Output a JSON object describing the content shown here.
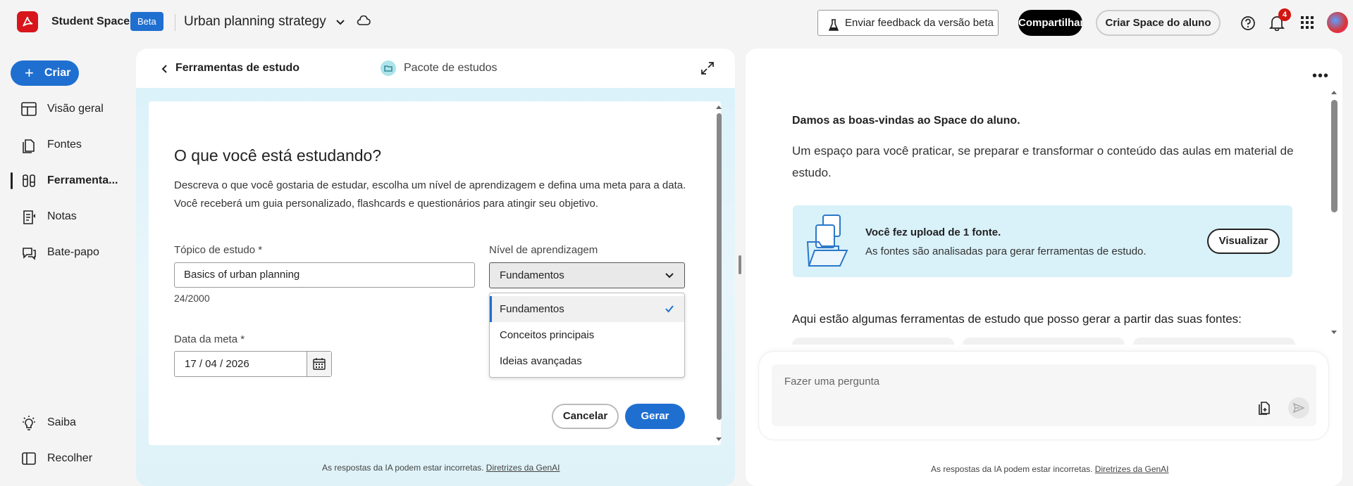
{
  "topbar": {
    "brand": "Student Spaces",
    "beta": "Beta",
    "document_title": "Urban planning strategy",
    "feedback_label": "Enviar feedback da versão beta",
    "share_label": "Compartilhar",
    "create_space_label": "Criar Space do aluno",
    "notification_count": "4"
  },
  "sidebar": {
    "create_label": "Criar",
    "items": [
      {
        "label": "Visão geral",
        "icon": "layout-icon"
      },
      {
        "label": "Fontes",
        "icon": "sources-icon"
      },
      {
        "label": "Ferramenta...",
        "icon": "tools-icon",
        "active": true
      },
      {
        "label": "Notas",
        "icon": "notes-icon"
      },
      {
        "label": "Bate-papo",
        "icon": "chat-icon"
      }
    ],
    "bottom": [
      {
        "label": "Saiba",
        "icon": "lightbulb-icon"
      },
      {
        "label": "Recolher",
        "icon": "collapse-icon"
      }
    ]
  },
  "left_panel": {
    "back_label": "Ferramentas de estudo",
    "pack_label": "Pacote de estudos",
    "form": {
      "title": "O que você está estudando?",
      "description_line1": "Descreva o que você gostaria de estudar, escolha um nível de aprendizagem e defina uma meta para a data.",
      "description_line2": "Você receberá um guia personalizado, flashcards e questionários para atingir seu objetivo.",
      "topic_label": "Tópico de estudo *",
      "topic_value": "Basics of urban planning",
      "char_count": "24/2000",
      "level_label": "Nível de aprendizagem",
      "level_value": "Fundamentos",
      "level_options": [
        "Fundamentos",
        "Conceitos principais",
        "Ideias avançadas"
      ],
      "date_label": "Data da meta *",
      "date_value": "17 / 04 / 2026",
      "cancel_label": "Cancelar",
      "generate_label": "Gerar"
    },
    "footnote": "As respostas da IA podem estar incorretas.",
    "footnote_link": "Diretrizes da GenAI"
  },
  "right_panel": {
    "welcome_title": "Damos as boas-vindas ao Space do aluno.",
    "welcome_text": "Um espaço para você praticar, se preparar e transformar o conteúdo das aulas em material de estudo.",
    "upload_title": "Você fez upload de 1 fonte.",
    "upload_subtitle": "As fontes são analisadas para gerar ferramentas de estudo.",
    "view_label": "Visualizar",
    "tools_intro": "Aqui estão algumas ferramentas de estudo que posso gerar a partir das suas fontes:",
    "ask_placeholder": "Fazer uma pergunta",
    "footnote": "As respostas da IA podem estar incorretas.",
    "footnote_link": "Diretrizes da GenAI"
  },
  "colors": {
    "accent": "#1f6fd0",
    "brand_red": "#d7151b",
    "panel_tint": "#d9f1f9"
  }
}
